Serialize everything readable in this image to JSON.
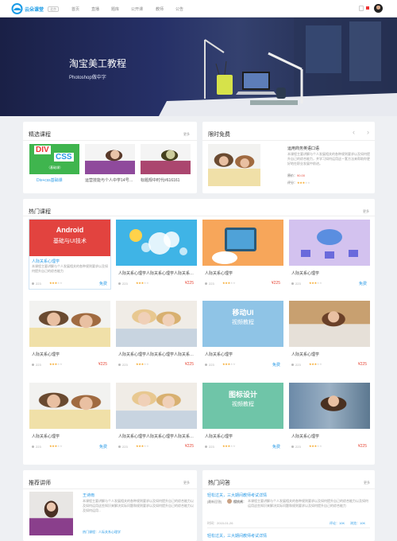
{
  "header": {
    "brand": "云朵课堂",
    "beta": "北京",
    "nav": [
      "首页",
      "直播",
      "题库",
      "公开课",
      "教师",
      "公告"
    ]
  },
  "banner": {
    "title": "淘宝美工教程",
    "subtitle": "Photoshop做中字"
  },
  "featured": {
    "title": "精选课程",
    "more": "更多",
    "items": [
      {
        "caption": "Div+css基础课",
        "overlay_top": "DIV",
        "overlay_bottom": "CSS",
        "overlay_sub": "（基础课）"
      },
      {
        "caption": "运营技能与个人中学14号学..."
      },
      {
        "caption": "标题规中时代#616161"
      }
    ]
  },
  "limited_free": {
    "title": "限时免费",
    "course_title": "运用商务英语口语",
    "desc": "本课程主要讲解与个人发展相关的各种规则要求以及如何提升自己的综合能力，并学习如何运用这一套方法来帮助你更好地在职业发展中前进。",
    "price_label": "原价：",
    "price": "90.00",
    "rating_label": "评分：",
    "rating": 3
  },
  "hot_courses": {
    "title": "热门课程",
    "more": "更多",
    "cards": [
      {
        "title": "人际关系心理学",
        "overlay": "Android",
        "overlay2": "基础与UI技术",
        "desc": "本课程主要讲解与个人发展相关的各种规则要求以及如何提升自己的综合能力",
        "students": "223",
        "rating": 3,
        "price": "免费",
        "free": true,
        "highlight": true
      },
      {
        "title": "人际关系心理学人际关系心理学人际关系心理...",
        "students": "223",
        "rating": 3,
        "price": "¥225",
        "free": false
      },
      {
        "title": "人际关系心理学",
        "students": "223",
        "rating": 3,
        "price": "¥225",
        "free": false
      },
      {
        "title": "人际关系心理学",
        "students": "223",
        "rating": 3,
        "price": "免费",
        "free": true
      },
      {
        "title": "人际关系心理学",
        "students": "223",
        "rating": 3,
        "price": "¥225",
        "free": false
      },
      {
        "title": "人际关系心理学人际关系心理学人际关系心理...",
        "students": "223",
        "rating": 3,
        "price": "¥225",
        "free": false
      },
      {
        "title": "人际关系心理学",
        "overlay": "移动UI",
        "overlay2": "视频教程",
        "students": "223",
        "rating": 3,
        "price": "免费",
        "free": true
      },
      {
        "title": "人际关系心理学",
        "students": "223",
        "rating": 3,
        "price": "¥225",
        "free": false
      },
      {
        "title": "人际关系心理学",
        "students": "223",
        "rating": 3,
        "price": "免费",
        "free": true
      },
      {
        "title": "人际关系心理学人际关系心理学人际关系心理...",
        "students": "223",
        "rating": 3,
        "price": "¥225",
        "free": false
      },
      {
        "title": "人际关系心理学",
        "overlay": "图标设计",
        "overlay2": "视频教程",
        "students": "223",
        "rating": 3,
        "price": "免费",
        "free": true
      },
      {
        "title": "人际关系心理学",
        "students": "223",
        "rating": 3,
        "price": "¥225",
        "free": false
      }
    ]
  },
  "teachers": {
    "title": "推荐讲师",
    "more": "更多",
    "name": "王诗雨",
    "desc": "本课程主要讲解与个人发展相关的各种规则要求以及如何提升自己的综合能力以及如何运用这些知识来解决实际问题和规则要求以及如何提升自己的综合能力以及如何运用...",
    "tags": "热门课程：人际关系心理学"
  },
  "qa": {
    "title": "热门问答",
    "more": "更多",
    "items": [
      {
        "question": "轻松过关，三大期间教师考试详情",
        "tag": "[最新回答]",
        "user": "樱桃酱：",
        "answer": "本课程主要讲解与个人发展相关的各种规则要求以及如何提升自己的综合能力以及如何运用这些知识来解决实际问题和规则要求以及如何提升自己的综合能力",
        "time": "时间：2015-01-26",
        "reviews": "评论：10K",
        "views": "浏览：10K"
      },
      {
        "question": "轻松过关，三大期间教师考试详情"
      }
    ]
  }
}
